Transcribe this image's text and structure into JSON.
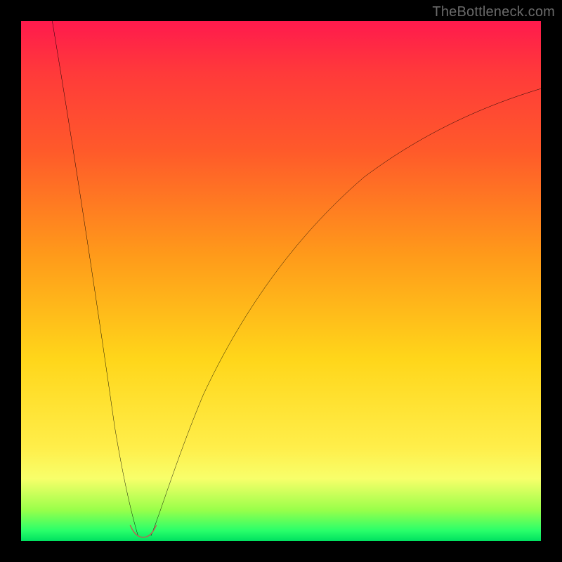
{
  "watermark": "TheBottleneck.com",
  "chart_data": {
    "type": "line",
    "title": "",
    "xlabel": "",
    "ylabel": "",
    "x_range": [
      0,
      100
    ],
    "y_range": [
      0,
      100
    ],
    "gradient_stops": [
      {
        "pos": 0,
        "color": "#ff1a4d"
      },
      {
        "pos": 10,
        "color": "#ff3a3a"
      },
      {
        "pos": 25,
        "color": "#ff5a2a"
      },
      {
        "pos": 45,
        "color": "#ff9a1a"
      },
      {
        "pos": 65,
        "color": "#ffd61a"
      },
      {
        "pos": 82,
        "color": "#ffee4a"
      },
      {
        "pos": 88,
        "color": "#f8ff6a"
      },
      {
        "pos": 94,
        "color": "#9aff4a"
      },
      {
        "pos": 98,
        "color": "#2aff6a"
      },
      {
        "pos": 100,
        "color": "#00e060"
      }
    ],
    "series": [
      {
        "name": "left-branch",
        "x": [
          6,
          8,
          10,
          12,
          14,
          16,
          18,
          19.5,
          21,
          22.5
        ],
        "y": [
          100,
          80,
          62,
          47,
          34,
          22,
          12,
          6,
          2,
          0
        ]
      },
      {
        "name": "right-branch",
        "x": [
          25,
          27,
          30,
          34,
          40,
          48,
          58,
          70,
          85,
          100
        ],
        "y": [
          0,
          4,
          12,
          23,
          37,
          51,
          63,
          73,
          81,
          87
        ]
      }
    ],
    "trough_marker": {
      "x_range": [
        21,
        25
      ],
      "y_range": [
        0,
        2.5
      ],
      "color": "#c45a52"
    }
  }
}
